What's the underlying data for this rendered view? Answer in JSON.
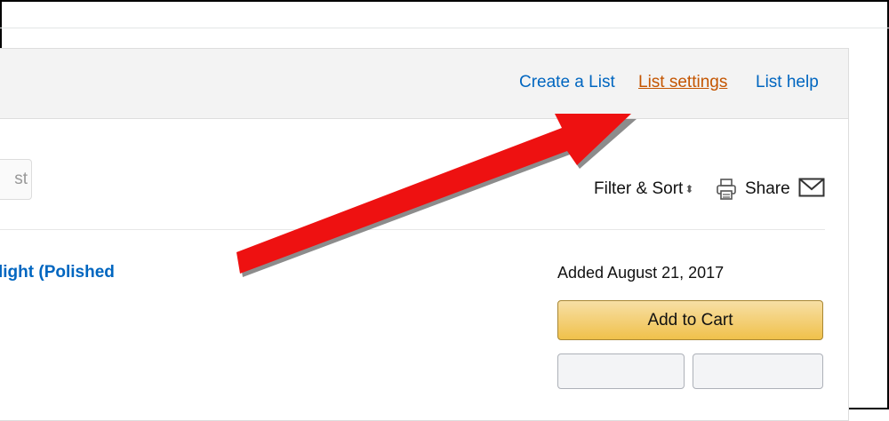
{
  "header": {
    "links": [
      {
        "label": "Create a List"
      },
      {
        "label": "List settings"
      },
      {
        "label": "List help"
      }
    ]
  },
  "search": {
    "partial_placeholder": "st"
  },
  "toolbar": {
    "filter_sort_label": "Filter & Sort",
    "filter_sort_caret": "⬍",
    "print_icon": "print-icon",
    "share_label": "Share",
    "mail_icon": "envelope-icon"
  },
  "item": {
    "title_fragment": "light (Polished",
    "added_date": "Added August 21, 2017",
    "add_to_cart_label": "Add to Cart"
  },
  "colors": {
    "link": "#0066c0",
    "active_link": "#c45500",
    "arrow": "#ee1111",
    "button": "#f0c14b"
  }
}
